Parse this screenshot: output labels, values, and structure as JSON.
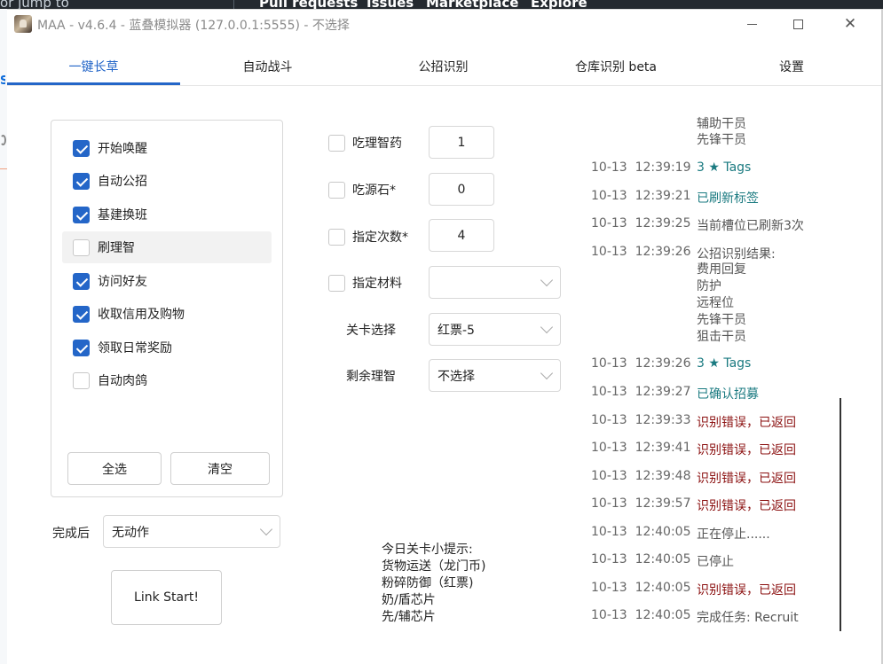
{
  "background": {
    "jump_text": "or jump to",
    "nav": [
      "Pull requests",
      "Issues",
      "Marketplace",
      "Explore"
    ]
  },
  "window": {
    "title": "MAA - v4.6.4 - 蓝叠模拟器 (127.0.0.1:5555) - 不选择",
    "controls": {
      "minimize_icon": "minimize-icon",
      "maximize_icon": "maximize-icon",
      "close_icon": "close-icon",
      "close_glyph": "✕"
    }
  },
  "tabs": [
    {
      "label": "一键长草",
      "active": true
    },
    {
      "label": "自动战斗",
      "active": false
    },
    {
      "label": "公招识别",
      "active": false
    },
    {
      "label": "仓库识别 beta",
      "active": false
    },
    {
      "label": "设置",
      "active": false
    }
  ],
  "tasks": [
    {
      "label": "开始唤醒",
      "checked": true
    },
    {
      "label": "自动公招",
      "checked": true
    },
    {
      "label": "基建换班",
      "checked": true
    },
    {
      "label": "刷理智",
      "checked": false
    },
    {
      "label": "访问好友",
      "checked": true
    },
    {
      "label": "收取信用及购物",
      "checked": true
    },
    {
      "label": "领取日常奖励",
      "checked": true
    },
    {
      "label": "自动肉鸽",
      "checked": false
    }
  ],
  "task_buttons": {
    "select_all": "全选",
    "clear": "清空"
  },
  "after_completion": {
    "label": "完成后",
    "value": "无动作"
  },
  "link_start": "Link Start!",
  "options": {
    "medicine": {
      "label": "吃理智药",
      "checked": false,
      "value": "1"
    },
    "stone": {
      "label": "吃源石*",
      "checked": false,
      "value": "0"
    },
    "times": {
      "label": "指定次数*",
      "checked": false,
      "value": "4"
    },
    "material": {
      "label": "指定材料",
      "checked": false,
      "value": ""
    },
    "stage": {
      "label": "关卡选择",
      "value": "红票-5"
    },
    "remaining_sanity": {
      "label": "剩余理智",
      "value": "不选择"
    }
  },
  "tips": {
    "title": "今日关卡小提示:",
    "lines": [
      "货物运送（龙门币)",
      "粉碎防御（红票)",
      "奶/盾芯片",
      "先/辅芯片"
    ]
  },
  "log": {
    "cont_top": [
      "辅助干员",
      "先锋干员"
    ],
    "entries": [
      {
        "date": "10-13",
        "time": "12:39:19",
        "msg": "3 ★ Tags",
        "color": "teal"
      },
      {
        "date": "10-13",
        "time": "12:39:21",
        "msg": "已刷新标签",
        "color": "teal"
      },
      {
        "date": "10-13",
        "time": "12:39:25",
        "msg": "当前槽位已刷新3次",
        "color": "gray"
      },
      {
        "date": "10-13",
        "time": "12:39:26",
        "msg": "公招识别结果:",
        "color": "gray"
      },
      {
        "date": "10-13",
        "time": "12:39:26",
        "msg": "3 ★ Tags",
        "color": "teal"
      },
      {
        "date": "10-13",
        "time": "12:39:27",
        "msg": "已确认招募",
        "color": "teal"
      },
      {
        "date": "10-13",
        "time": "12:39:33",
        "msg": "识别错误，已返回",
        "color": "red"
      },
      {
        "date": "10-13",
        "time": "12:39:41",
        "msg": "识别错误，已返回",
        "color": "red"
      },
      {
        "date": "10-13",
        "time": "12:39:48",
        "msg": "识别错误，已返回",
        "color": "red"
      },
      {
        "date": "10-13",
        "time": "12:39:57",
        "msg": "识别错误，已返回",
        "color": "red"
      },
      {
        "date": "10-13",
        "time": "12:40:05",
        "msg": "正在停止......",
        "color": "gray"
      },
      {
        "date": "10-13",
        "time": "12:40:05",
        "msg": "已停止",
        "color": "gray"
      },
      {
        "date": "10-13",
        "time": "12:40:05",
        "msg": "识别错误，已返回",
        "color": "red"
      },
      {
        "date": "10-13",
        "time": "12:40:05",
        "msg": "完成任务: Recruit",
        "color": "gray"
      }
    ],
    "recruit_result_lines": [
      "费用回复",
      "防护",
      "远程位",
      "先锋干员",
      "狙击干员"
    ]
  },
  "colors": {
    "accent": "#2466c8",
    "log_teal": "#1a7a80",
    "log_red": "#8b1010",
    "log_gray": "#555555"
  }
}
